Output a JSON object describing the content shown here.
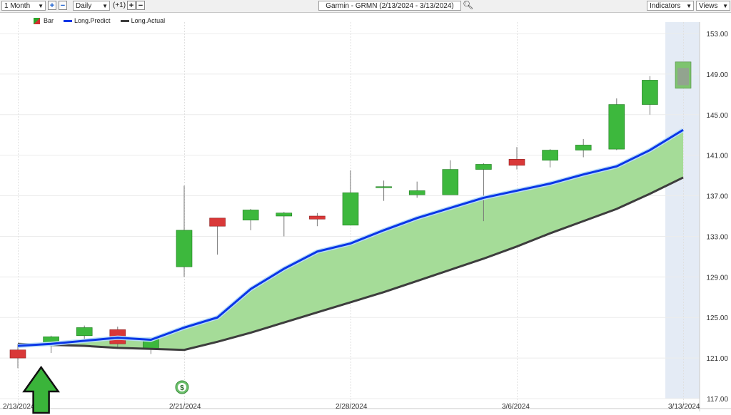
{
  "toolbar": {
    "period": "1 Month",
    "interval": "Daily",
    "offset": "(+1)",
    "title": "Garmin - GRMN (2/13/2024 - 3/13/2024)",
    "indicators": "Indicators",
    "views": "Views",
    "plus_label": "+",
    "minus_label": "−"
  },
  "colors": {
    "up": "#3db83d",
    "down": "#d93838",
    "predict": "#0a36e6",
    "actual": "#3d3d3d",
    "fill": "#a5dc98",
    "forecast_shade": "#e4ebf5"
  },
  "chart_data": {
    "type": "candlestick",
    "title": "Garmin - GRMN (2/13/2024 - 3/13/2024)",
    "legend": [
      "Bar",
      "Long.Predict",
      "Long.Actual"
    ],
    "legend_placement": "top-left",
    "ylim": [
      117,
      153
    ],
    "yticks": [
      "153.00",
      "149.00",
      "145.00",
      "141.00",
      "137.00",
      "133.00",
      "129.00",
      "125.00",
      "121.00",
      "117.00"
    ],
    "xticks": [
      "2/13/2024",
      "2/21/2024",
      "2/28/2024",
      "3/6/2024",
      "3/13/2024"
    ],
    "grid": true,
    "candles": [
      {
        "o": 121.8,
        "h": 122.4,
        "l": 120.0,
        "c": 121.0
      },
      {
        "o": 122.2,
        "h": 123.2,
        "l": 121.5,
        "c": 123.1
      },
      {
        "o": 123.2,
        "h": 124.2,
        "l": 122.6,
        "c": 124.0
      },
      {
        "o": 123.8,
        "h": 124.1,
        "l": 122.0,
        "c": 122.4
      },
      {
        "o": 121.9,
        "h": 123.0,
        "l": 121.4,
        "c": 123.0
      },
      {
        "o": 130.0,
        "h": 138.0,
        "l": 129.0,
        "c": 133.6
      },
      {
        "o": 134.8,
        "h": 134.8,
        "l": 131.2,
        "c": 134.0
      },
      {
        "o": 134.6,
        "h": 135.7,
        "l": 133.6,
        "c": 135.6
      },
      {
        "o": 135.0,
        "h": 135.4,
        "l": 133.0,
        "c": 135.3
      },
      {
        "o": 135.0,
        "h": 135.3,
        "l": 134.0,
        "c": 134.7
      },
      {
        "o": 134.1,
        "h": 139.5,
        "l": 134.1,
        "c": 137.3
      },
      {
        "o": 137.9,
        "h": 138.5,
        "l": 136.5,
        "c": 137.9
      },
      {
        "o": 137.1,
        "h": 138.4,
        "l": 136.8,
        "c": 137.5
      },
      {
        "o": 137.1,
        "h": 140.5,
        "l": 137.1,
        "c": 139.6
      },
      {
        "o": 139.6,
        "h": 140.2,
        "l": 134.5,
        "c": 140.1
      },
      {
        "o": 140.6,
        "h": 141.8,
        "l": 139.6,
        "c": 140.0
      },
      {
        "o": 140.5,
        "h": 141.6,
        "l": 139.8,
        "c": 141.5
      },
      {
        "o": 141.5,
        "h": 142.6,
        "l": 140.8,
        "c": 142.0
      },
      {
        "o": 141.6,
        "h": 146.6,
        "l": 141.5,
        "c": 146.0
      },
      {
        "o": 146.0,
        "h": 148.8,
        "l": 145.0,
        "c": 148.4
      }
    ],
    "forecast_candle": {
      "o": 147.6,
      "h": 150.2,
      "l": 147.6,
      "c": 150.2
    },
    "long_predict": [
      122.2,
      122.4,
      122.7,
      123.0,
      122.8,
      124.0,
      125.0,
      127.8,
      129.8,
      131.5,
      132.3,
      133.6,
      134.8,
      135.8,
      136.8,
      137.5,
      138.2,
      139.1,
      139.9,
      141.5,
      143.5
    ],
    "long_actual": [
      122.4,
      122.3,
      122.2,
      122.0,
      121.9,
      121.8,
      122.6,
      123.5,
      124.5,
      125.5,
      126.5,
      127.5,
      128.6,
      129.7,
      130.8,
      132.0,
      133.3,
      134.5,
      135.7,
      137.2,
      138.8
    ]
  }
}
